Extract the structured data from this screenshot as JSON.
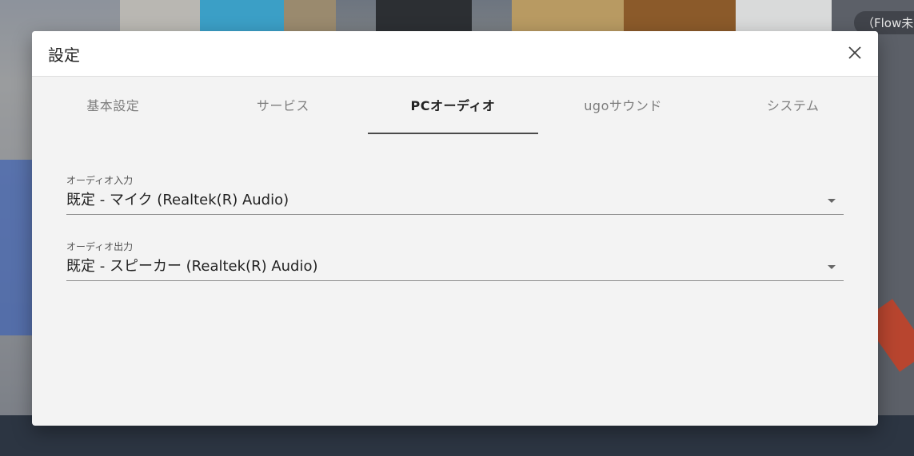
{
  "background_overlay": {
    "label": "（Flow未設"
  },
  "dialog": {
    "title": "設定",
    "close_icon": "close-icon"
  },
  "tabs": [
    {
      "label": "基本設定",
      "active": false
    },
    {
      "label": "サービス",
      "active": false
    },
    {
      "label": "PCオーディオ",
      "active": true
    },
    {
      "label": "ugoサウンド",
      "active": false
    },
    {
      "label": "システム",
      "active": false
    }
  ],
  "fields": {
    "audio_input": {
      "label": "オーディオ入力",
      "value": "既定 - マイク (Realtek(R) Audio)"
    },
    "audio_output": {
      "label": "オーディオ出力",
      "value": "既定 - スピーカー (Realtek(R) Audio)"
    }
  },
  "colors": {
    "dialog_bg": "#f3f3f3",
    "header_bg": "#ffffff",
    "active_tab_underline": "#4a4a4a"
  }
}
